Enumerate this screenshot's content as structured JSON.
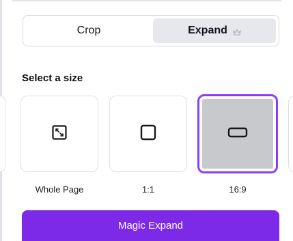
{
  "mode_tabs": {
    "crop_label": "Crop",
    "expand_label": "Expand",
    "expand_icon": "crown-icon",
    "selected": "Expand"
  },
  "size_section": {
    "title": "Select a size",
    "options": [
      {
        "label": "Whole Page",
        "icon": "expand-arrows-icon",
        "selected": false
      },
      {
        "label": "1:1",
        "icon": "square-icon",
        "selected": false
      },
      {
        "label": "16:9",
        "icon": "wide-rectangle-icon",
        "selected": true
      }
    ]
  },
  "primary_button": {
    "label": "Magic Expand"
  },
  "colors": {
    "accent": "#8b3dff",
    "button": "#7d2ae8",
    "selected_tab_bg": "#e6e8ec",
    "selected_tile_fill": "#c8c9cd"
  }
}
